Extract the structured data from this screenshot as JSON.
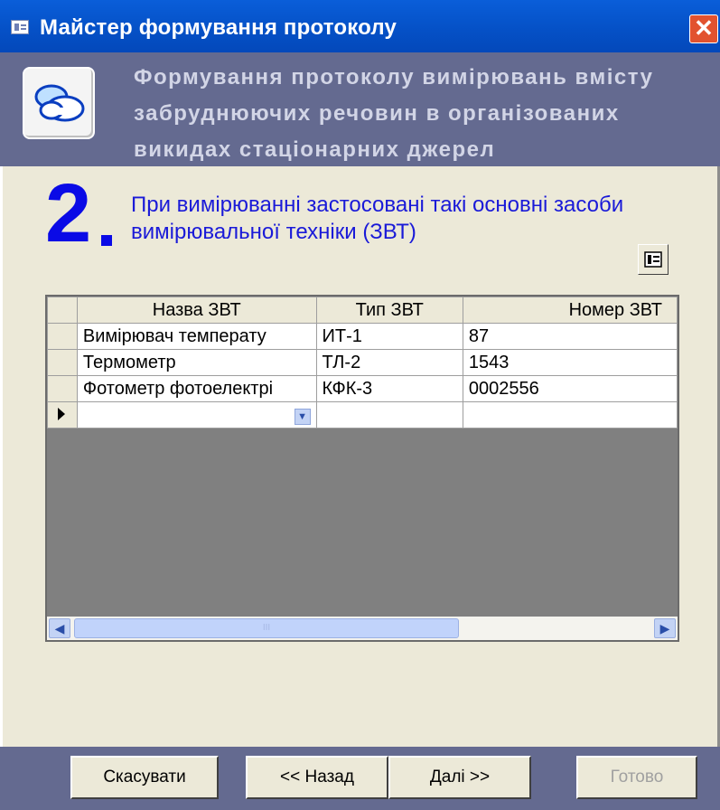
{
  "window": {
    "title": "Майстер формування протоколу",
    "close_glyph": "✕"
  },
  "header": {
    "text": "Формування протоколу вимірювань вмісту забруднюючих речовин в організованих викидах стаціонарних джерел",
    "icon": "clouds-icon"
  },
  "step": {
    "number": "2",
    "text": "При вимірюванні застосовані такі основні засоби вимірювальної техніки (ЗВТ)"
  },
  "grid": {
    "columns": [
      "Назва ЗВТ",
      "Тип ЗВТ",
      "Номер ЗВТ"
    ],
    "rows": [
      [
        "Вимірювач температу",
        "ИТ-1",
        "87"
      ],
      [
        "Термометр",
        "ТЛ-2",
        "1543"
      ],
      [
        "Фотометр фотоелектрі",
        "КФК-3",
        "0002556"
      ]
    ],
    "scroll_grip": "III"
  },
  "buttons": {
    "cancel": "Скасувати",
    "back": "<< Назад",
    "next": "Далі >>",
    "finish": "Готово"
  },
  "colors": {
    "title_bar": "#0a5ed9",
    "header_panel": "#646a90",
    "step_blue": "#0a0ae6",
    "window_bg": "#ece9d8"
  }
}
